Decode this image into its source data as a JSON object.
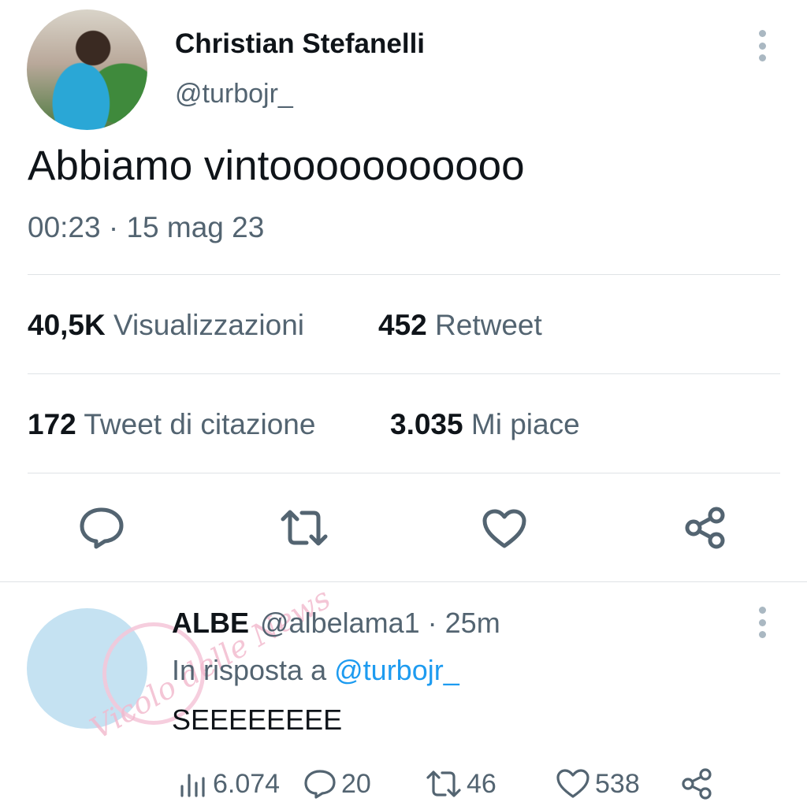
{
  "tweet": {
    "author_name": "Christian Stefanelli",
    "author_handle": "@turbojr_",
    "text": "Abbiamo vintooooooooooo",
    "timestamp": "00:23 · 15 mag 23",
    "stats": {
      "views_value": "40,5K",
      "views_label": "Visualizzazioni",
      "retweets_value": "452",
      "retweets_label": "Retweet",
      "quotes_value": "172",
      "quotes_label": "Tweet di citazione",
      "likes_value": "3.035",
      "likes_label": "Mi piace"
    },
    "actions": [
      "reply-icon",
      "retweet-icon",
      "like-icon",
      "share-icon"
    ]
  },
  "reply": {
    "author_name": "ALBE",
    "meta": "@albelama1 · 25m",
    "context_prefix": "In risposta a",
    "context_mention": "@turbojr_",
    "text": "SEEEEEEEE",
    "views": "6.074",
    "replies": "20",
    "retweets": "46",
    "likes": "538"
  },
  "watermark": {
    "text": "Vicolo delle News"
  },
  "colors": {
    "text": "#0f1419",
    "secondary": "#536471",
    "link": "#1d9bf0",
    "divider": "#dfe3e6"
  }
}
